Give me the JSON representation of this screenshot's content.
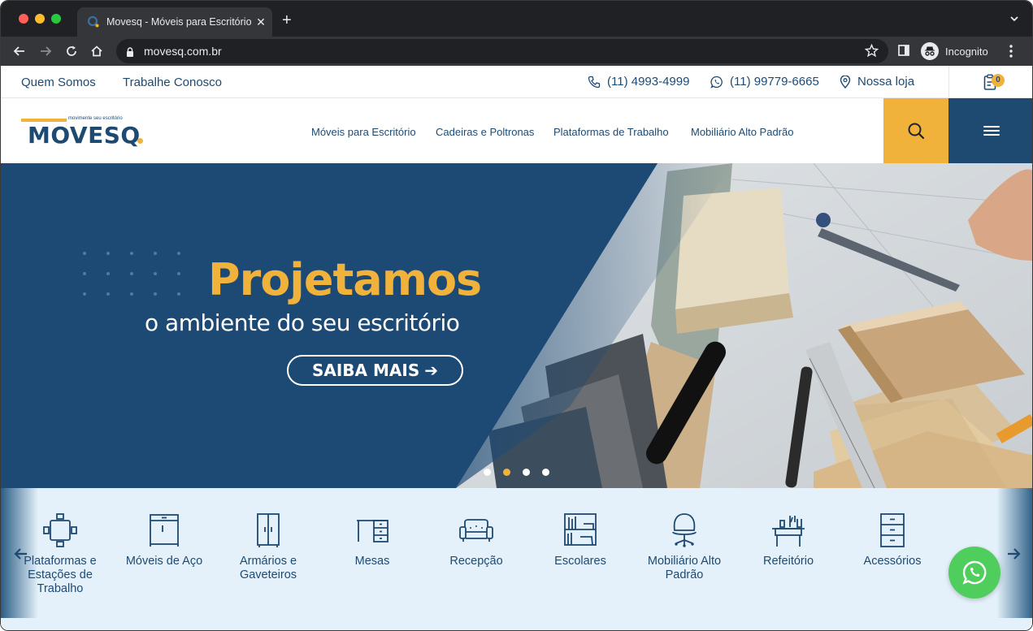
{
  "browser": {
    "tab_title": "Movesq - Móveis para Escritório",
    "tab_close": "✕",
    "new_tab": "+",
    "url": "movesq.com.br",
    "profile_label": "Incognito"
  },
  "topbar": {
    "links": [
      "Quem Somos",
      "Trabalhe Conosco"
    ],
    "phone": "(11) 4993-4999",
    "whatsapp": "(11) 99779-6665",
    "store": "Nossa loja",
    "cart_count": "0"
  },
  "header": {
    "logo_tagline": "movimente seu escritório",
    "logo_text": "MOVESQ",
    "menu": [
      "Móveis para Escritório",
      "Cadeiras e Poltronas",
      "Plataformas de Trabalho",
      "Mobiliário Alto Padrão"
    ]
  },
  "hero": {
    "title": "Projetamos",
    "subtitle": "o ambiente do seu escritório",
    "button": "SAIBA MAIS",
    "button_arrow": "➔",
    "active_slide": 2,
    "slide_count": 4
  },
  "categories": [
    {
      "label": "Plataformas e Estações de Trabalho",
      "icon": "workstation-icon"
    },
    {
      "label": "Móveis de Aço",
      "icon": "steel-cabinet-icon"
    },
    {
      "label": "Armários e Gaveteiros",
      "icon": "wardrobe-icon"
    },
    {
      "label": "Mesas",
      "icon": "desk-icon"
    },
    {
      "label": "Recepção",
      "icon": "sofa-icon"
    },
    {
      "label": "Escolares",
      "icon": "bookshelf-icon"
    },
    {
      "label": "Mobiliário Alto Padrão",
      "icon": "office-chair-icon"
    },
    {
      "label": "Refeitório",
      "icon": "dining-table-icon"
    },
    {
      "label": "Acessórios",
      "icon": "drawer-unit-icon"
    }
  ],
  "colors": {
    "brand_blue": "#1e4a72",
    "brand_yellow": "#f0b23b",
    "hero_bg": "#1d4a74",
    "category_bg": "#e4f1fa",
    "whatsapp_green": "#4fce5d"
  }
}
